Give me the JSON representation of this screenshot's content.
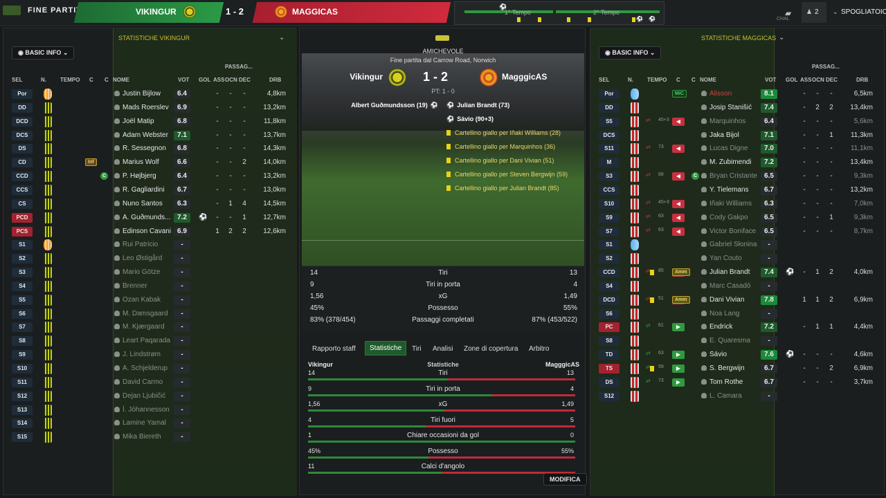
{
  "topbar": {
    "label": "FINE PARTITA",
    "home": "VIKINGUR",
    "score": "1 - 2",
    "away": "MAGGICAS",
    "first_half": "1° Tempo",
    "second_half": "2° Tempo",
    "count": "2",
    "dressing": "SPOGLIATOIO",
    "chat": "CHAL"
  },
  "left": {
    "header": "STATISTICHE VIKINGUR",
    "basic_info": "BASIC INFO",
    "cols": {
      "sel": "SEL",
      "n": "N.",
      "tempo": "TEMPO",
      "c": "C",
      "c2": "C",
      "nome": "NOME",
      "vot": "VOT",
      "gol": "GOL",
      "ass": "ASS",
      "passag": "PASSAG...",
      "ocn": "OCN",
      "dec": "DEC",
      "drb": "DRB"
    },
    "players": [
      {
        "sel": "Por",
        "name": "Justin Bijlow",
        "vot": "6.4",
        "gol": "",
        "ass": "-",
        "ocn": "-",
        "dec": "-",
        "drb": "4,8km",
        "gk": true
      },
      {
        "sel": "DD",
        "name": "Mads Roerslev",
        "vot": "6.9",
        "gol": "",
        "ass": "-",
        "ocn": "-",
        "dec": "-",
        "drb": "13,2km"
      },
      {
        "sel": "DCD",
        "name": "Joël Matip",
        "vot": "6.8",
        "gol": "",
        "ass": "-",
        "ocn": "-",
        "dec": "-",
        "drb": "11,8km"
      },
      {
        "sel": "DCS",
        "name": "Adam Webster",
        "vot": "7.1",
        "gol": "",
        "ass": "-",
        "ocn": "-",
        "dec": "-",
        "drb": "13,7km",
        "hi": true
      },
      {
        "sel": "DS",
        "name": "R. Sessegnon",
        "vot": "6.8",
        "gol": "",
        "ass": "-",
        "ocn": "-",
        "dec": "-",
        "drb": "14,3km"
      },
      {
        "sel": "CD",
        "name": "Marius Wolf",
        "vot": "6.6",
        "gol": "",
        "ass": "-",
        "ocn": "-",
        "dec": "2",
        "drb": "14,0km",
        "badge": "Inf"
      },
      {
        "sel": "CCD",
        "name": "P. Højbjerg",
        "vot": "6.4",
        "gol": "",
        "ass": "-",
        "ocn": "-",
        "dec": "-",
        "drb": "13,2km",
        "cap": "C"
      },
      {
        "sel": "CCS",
        "name": "R. Gagliardini",
        "vot": "6.7",
        "gol": "",
        "ass": "-",
        "ocn": "-",
        "dec": "-",
        "drb": "13,0km"
      },
      {
        "sel": "CS",
        "name": "Nuno Santos",
        "vot": "6.3",
        "gol": "",
        "ass": "-",
        "ocn": "1",
        "dec": "4",
        "drb": "14,5km"
      },
      {
        "sel": "PCD",
        "name": "A. Guðmunds...",
        "vot": "7.2",
        "gol": "⚽",
        "ass": "-",
        "ocn": "-",
        "dec": "1",
        "drb": "12,7km",
        "hi": true,
        "red": true
      },
      {
        "sel": "PCS",
        "name": "Edinson Cavani",
        "vot": "6.9",
        "gol": "",
        "ass": "1",
        "ocn": "2",
        "dec": "2",
        "drb": "12,6km",
        "red": true
      },
      {
        "sel": "S1",
        "name": "Rui Patricio",
        "vot": "-",
        "dim": true,
        "gk": true
      },
      {
        "sel": "S2",
        "name": "Leo Østigård",
        "vot": "-",
        "dim": true
      },
      {
        "sel": "S3",
        "name": "Mario Götze",
        "vot": "-",
        "dim": true
      },
      {
        "sel": "S4",
        "name": "Brenner",
        "vot": "-",
        "dim": true
      },
      {
        "sel": "S5",
        "name": "Ozan Kabak",
        "vot": "-",
        "dim": true
      },
      {
        "sel": "S6",
        "name": "M. Damsgaard",
        "vot": "-",
        "dim": true
      },
      {
        "sel": "S7",
        "name": "M. Kjærgaard",
        "vot": "-",
        "dim": true
      },
      {
        "sel": "S8",
        "name": "Leart Paqarada",
        "vot": "-",
        "dim": true
      },
      {
        "sel": "S9",
        "name": "J. Lindstrøm",
        "vot": "-",
        "dim": true
      },
      {
        "sel": "S10",
        "name": "A. Schjelderup",
        "vot": "-",
        "dim": true
      },
      {
        "sel": "S11",
        "name": "David Carmo",
        "vot": "-",
        "dim": true
      },
      {
        "sel": "S12",
        "name": "Dejan Ljubičić",
        "vot": "-",
        "dim": true
      },
      {
        "sel": "S13",
        "name": "Í. Jóhannesson",
        "vot": "-",
        "dim": true
      },
      {
        "sel": "S14",
        "name": "Lamine Yamal",
        "vot": "-",
        "dim": true
      },
      {
        "sel": "S15",
        "name": "Mika Biereth",
        "vot": "-",
        "dim": true
      }
    ]
  },
  "right": {
    "header": "STATISTICHE MAGGICAS",
    "basic_info": "BASIC INFO",
    "cols": {
      "sel": "SEL",
      "n": "N.",
      "tempo": "TEMPO",
      "c": "C",
      "c2": "C",
      "nome": "NOME",
      "vot": "VOT",
      "gol": "GOL",
      "ass": "ASS",
      "passag": "PASSAG...",
      "ocn": "OCN",
      "dec": "DEC",
      "drb": "DRB"
    },
    "players": [
      {
        "sel": "Por",
        "name": "Alisson",
        "vot": "8.1",
        "ass": "-",
        "ocn": "-",
        "dec": "-",
        "drb": "6,5km",
        "gk": true,
        "namered": true,
        "top": true,
        "badge": "MiC"
      },
      {
        "sel": "DD",
        "name": "Josip Stanišić",
        "vot": "7.4",
        "ass": "-",
        "ocn": "2",
        "dec": "2",
        "drb": "13,4km",
        "hi": true
      },
      {
        "sel": "S5",
        "name": "Marquinhos",
        "vot": "6.4",
        "ass": "-",
        "ocn": "-",
        "dec": "-",
        "drb": "5,6km",
        "dim": true,
        "sub": "45+3",
        "out": true
      },
      {
        "sel": "DCS",
        "name": "Jaka Bijol",
        "vot": "7.1",
        "ass": "-",
        "ocn": "-",
        "dec": "1",
        "drb": "11,3km",
        "hi": true
      },
      {
        "sel": "S11",
        "name": "Lucas Digne",
        "vot": "7.0",
        "ass": "-",
        "ocn": "-",
        "dec": "-",
        "drb": "11,1km",
        "hi": true,
        "dim": true,
        "sub": "73",
        "out": true
      },
      {
        "sel": "M",
        "name": "M. Zubimendi",
        "vot": "7.2",
        "ass": "-",
        "ocn": "-",
        "dec": "-",
        "drb": "13,4km",
        "hi": true
      },
      {
        "sel": "S3",
        "name": "Bryan Cristante",
        "vot": "6.5",
        "ass": "-",
        "ocn": "-",
        "dec": "-",
        "drb": "9,3km",
        "dim": true,
        "sub": "68",
        "out": true,
        "cap": "C"
      },
      {
        "sel": "CCS",
        "name": "Y. Tielemans",
        "vot": "6.7",
        "ass": "-",
        "ocn": "-",
        "dec": "-",
        "drb": "13,2km"
      },
      {
        "sel": "S10",
        "name": "Iñaki Williams",
        "vot": "6.3",
        "ass": "-",
        "ocn": "-",
        "dec": "-",
        "drb": "7,0km",
        "dim": true,
        "sub": "45+3",
        "out": true
      },
      {
        "sel": "S9",
        "name": "Cody Gakpo",
        "vot": "6.5",
        "ass": "-",
        "ocn": "-",
        "dec": "1",
        "drb": "9,3km",
        "dim": true,
        "sub": "63",
        "out": true
      },
      {
        "sel": "S7",
        "name": "Victor Boniface",
        "vot": "6.5",
        "ass": "-",
        "ocn": "-",
        "dec": "-",
        "drb": "8,7km",
        "dim": true,
        "sub": "63",
        "out": true
      },
      {
        "sel": "S1",
        "name": "Gabriel Słonina",
        "vot": "-",
        "dim": true,
        "gk": true
      },
      {
        "sel": "S2",
        "name": "Yan Couto",
        "vot": "-",
        "dim": true
      },
      {
        "sel": "CCD",
        "name": "Julian Brandt",
        "vot": "7.4",
        "gol": "⚽",
        "ass": "-",
        "ocn": "1",
        "dec": "2",
        "drb": "4,0km",
        "hi": true,
        "sub": "85",
        "yc": true,
        "badge": "Amm"
      },
      {
        "sel": "S4",
        "name": "Marc Casadó",
        "vot": "-",
        "dim": true
      },
      {
        "sel": "DCD",
        "name": "Dani Vivian",
        "vot": "7.8",
        "ass": "1",
        "ocn": "1",
        "dec": "2",
        "drb": "6,9km",
        "top": true,
        "sub": "51",
        "yc": true,
        "badge": "Amm"
      },
      {
        "sel": "S6",
        "name": "Noa Lang",
        "vot": "-",
        "dim": true
      },
      {
        "sel": "PC",
        "name": "Endrick",
        "vot": "7.2",
        "ass": "-",
        "ocn": "1",
        "dec": "1",
        "drb": "4,4km",
        "hi": true,
        "red": true,
        "sub": "61",
        "in": true
      },
      {
        "sel": "S8",
        "name": "E. Quaresma",
        "vot": "-",
        "dim": true
      },
      {
        "sel": "TD",
        "name": "Sávio",
        "vot": "7.6",
        "gol": "⚽",
        "ass": "-",
        "ocn": "-",
        "dec": "-",
        "drb": "4,6km",
        "top": true,
        "sub": "63",
        "in": true
      },
      {
        "sel": "TS",
        "name": "S. Bergwijn",
        "vot": "6.7",
        "ass": "-",
        "ocn": "-",
        "dec": "2",
        "drb": "6,9km",
        "red": true,
        "sub": "59",
        "in": true,
        "yc": true
      },
      {
        "sel": "DS",
        "name": "Tom Rothe",
        "vot": "6.7",
        "ass": "-",
        "ocn": "-",
        "dec": "-",
        "drb": "3,7km",
        "sub": "73",
        "in": true
      },
      {
        "sel": "S12",
        "name": "L. Camara",
        "vot": "-",
        "dim": true
      }
    ]
  },
  "match": {
    "type": "AMICHEVOLE",
    "result": "Fine partita dal Carrow Road, Norwich",
    "home": "Vikingur",
    "score": "1 - 2",
    "away": "MagggicAS",
    "ht": "PT: 1 - 0",
    "home_events": [
      "Albert Guðmundsson (19)"
    ],
    "away_events": [
      "Julian Brandt (73)",
      "Sávio (90+3)",
      "Cartellino giallo per Iñaki Williams (28)",
      "Cartellino giallo per Marquinhos (36)",
      "Cartellino giallo per Dani Vivian (51)",
      "Cartellino giallo per Steven Bergwijn (59)",
      "Cartellino giallo per Julian Brandt (85)"
    ]
  },
  "summary": [
    {
      "h": "14",
      "l": "Tiri",
      "a": "13"
    },
    {
      "h": "9",
      "l": "Tiri in porta",
      "a": "4"
    },
    {
      "h": "1,56",
      "l": "xG",
      "a": "1,49"
    },
    {
      "h": "45%",
      "l": "Possesso",
      "a": "55%"
    },
    {
      "h": "83% (378/454)",
      "l": "Passaggi completati",
      "a": "87% (453/522)"
    }
  ],
  "tabs": [
    "Rapporto staff",
    "Statistiche",
    "Tiri",
    "Analisi",
    "Zone di copertura",
    "Arbitro"
  ],
  "compare": {
    "home": "Vikingur",
    "title": "Statistiche",
    "away": "MagggicAS",
    "rows": [
      {
        "h": "14",
        "l": "Tiri",
        "a": "13",
        "share": 0.52
      },
      {
        "h": "9",
        "l": "Tiri in porta",
        "a": "4",
        "share": 0.69
      },
      {
        "h": "1,56",
        "l": "xG",
        "a": "1,49",
        "share": 0.51
      },
      {
        "h": "4",
        "l": "Tiri fuori",
        "a": "5",
        "share": 0.44
      },
      {
        "h": "1",
        "l": "Chiare occasioni da gol",
        "a": "0",
        "share": 1.0
      },
      {
        "h": "45%",
        "l": "Possesso",
        "a": "55%",
        "share": 0.45
      },
      {
        "h": "11",
        "l": "Calci d'angolo",
        "a": "",
        "share": 0.5
      }
    ]
  },
  "modifica": "MODIFICA"
}
